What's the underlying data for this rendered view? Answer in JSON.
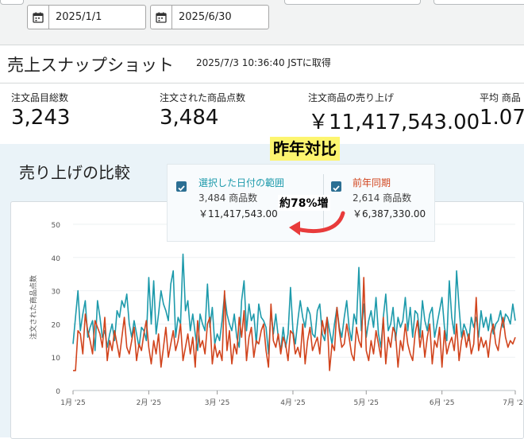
{
  "date_range": {
    "start": "2025/1/1",
    "end": "2025/6/30"
  },
  "header": {
    "title": "売上スナップショット",
    "fetched": "2025/7/3 10:36:40 JSTに取得"
  },
  "metrics": [
    {
      "label": "注文品目総数",
      "value": "3,243"
    },
    {
      "label": "注文された商品点数",
      "value": "3,484"
    },
    {
      "label": "注文商品の売り上げ",
      "value": "￥11,417,543.00"
    },
    {
      "label": "平均 商品",
      "value": "1.07"
    }
  ],
  "comparison": {
    "title": "売り上げの比較",
    "annotation_title": "昨年対比",
    "annotation_increase": "約78%増",
    "legend": [
      {
        "name": "選択した日付の範囲",
        "count": "3,484 商品数",
        "sales": "￥11,417,543.00",
        "color": "#1d9aab"
      },
      {
        "name": "前年同期",
        "count": "2,614 商品数",
        "sales": "￥6,387,330.00",
        "color": "#d1441d"
      }
    ],
    "checkbox_icon": "check-icon",
    "arrow_color": "#e83b3b"
  },
  "chart_data": {
    "type": "line",
    "ylabel": "注文された商品点数",
    "ylim": [
      0,
      50
    ],
    "yticks": [
      "0",
      "10",
      "20",
      "30",
      "40",
      "50"
    ],
    "xticks": [
      "1月 '25",
      "2月 '25",
      "3月 '25",
      "4月 '25",
      "5月 '25",
      "6月 '25",
      "7月 '25"
    ],
    "xtick_days": [
      0,
      31,
      59,
      90,
      120,
      151,
      181
    ],
    "grid": true,
    "series": [
      {
        "name": "選択した日付の範囲",
        "color": "#1d9aab",
        "values": [
          14,
          22,
          30,
          18,
          23,
          27,
          16,
          19,
          21,
          12,
          27,
          22,
          16,
          18,
          13,
          17,
          20,
          15,
          24,
          22,
          27,
          25,
          29,
          20,
          16,
          21,
          17,
          13,
          19,
          18,
          15,
          34,
          20,
          33,
          17,
          23,
          30,
          26,
          24,
          21,
          32,
          36,
          16,
          22,
          20,
          41,
          24,
          27,
          18,
          23,
          17,
          12,
          23,
          20,
          18,
          32,
          19,
          25,
          14,
          17,
          15,
          21,
          29,
          23,
          20,
          18,
          23,
          16,
          13,
          27,
          33,
          18,
          26,
          21,
          23,
          14,
          26,
          22,
          21,
          19,
          11,
          24,
          17,
          23,
          16,
          12,
          19,
          13,
          17,
          31,
          18,
          14,
          21,
          27,
          22,
          19,
          25,
          23,
          17,
          16,
          24,
          26,
          17,
          15,
          22,
          18,
          14,
          20,
          25,
          19,
          16,
          22,
          27,
          19,
          15,
          23,
          20,
          37,
          18,
          26,
          16,
          21,
          24,
          19,
          28,
          17,
          13,
          22,
          29,
          18,
          20,
          25,
          15,
          22,
          19,
          21,
          28,
          18,
          25,
          16,
          24,
          23,
          16,
          27,
          21,
          18,
          23,
          25,
          16,
          20,
          24,
          28,
          19,
          15,
          33,
          22,
          17,
          36,
          25,
          16,
          20,
          18,
          15,
          22,
          19,
          22,
          16,
          24,
          19,
          22,
          18,
          23,
          17,
          20,
          21,
          24,
          19,
          23,
          22,
          20,
          26,
          21
        ]
      },
      {
        "name": "前年同期",
        "color": "#d1441d",
        "values": [
          6,
          6,
          18,
          17,
          11,
          23,
          18,
          15,
          11,
          21,
          19,
          17,
          13,
          22,
          9,
          15,
          12,
          18,
          14,
          10,
          16,
          22,
          13,
          11,
          15,
          19,
          9,
          14,
          12,
          17,
          21,
          13,
          8,
          15,
          11,
          17,
          7,
          13,
          19,
          10,
          14,
          18,
          12,
          15,
          20,
          9,
          13,
          17,
          11,
          16,
          7,
          21,
          13,
          15,
          11,
          20,
          22,
          8,
          14,
          10,
          12,
          9,
          30,
          12,
          18,
          8,
          14,
          11,
          22,
          16,
          24,
          9,
          16,
          19,
          10,
          15,
          14,
          18,
          20,
          12,
          7,
          26,
          15,
          13,
          17,
          11,
          16,
          14,
          9,
          18,
          17,
          11,
          13,
          10,
          20,
          8,
          15,
          19,
          12,
          14,
          16,
          11,
          21,
          17,
          22,
          6,
          14,
          12,
          25,
          18,
          13,
          14,
          20,
          16,
          11,
          9,
          19,
          15,
          13,
          34,
          12,
          9,
          15,
          11,
          18,
          14,
          10,
          22,
          8,
          16,
          13,
          19,
          17,
          7,
          15,
          12,
          20,
          14,
          11,
          9,
          17,
          21,
          13,
          18,
          10,
          16,
          20,
          8,
          15,
          13,
          19,
          7,
          18,
          11,
          14,
          16,
          12,
          20,
          9,
          15,
          18,
          13,
          17,
          11,
          14,
          28,
          12,
          16,
          13,
          15,
          10,
          17,
          20,
          14,
          12,
          18,
          22,
          16,
          13,
          15,
          14,
          16
        ]
      }
    ]
  }
}
